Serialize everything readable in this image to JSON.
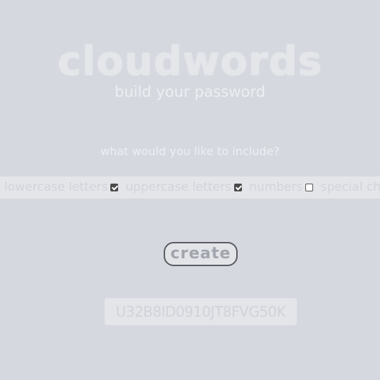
{
  "header": {
    "logo_text": "cloudwords",
    "subtitle": "build your password"
  },
  "options": {
    "question": "what would you like to include?",
    "items": [
      {
        "label": "lowercase letters",
        "checked": true
      },
      {
        "label": "uppercase letters",
        "checked": true
      },
      {
        "label": "numbers",
        "checked": false
      },
      {
        "label": "special characters",
        "checked": false
      }
    ]
  },
  "actions": {
    "create_label": "create"
  },
  "result": {
    "password": "U32B8ID0910JT8FVG50K"
  },
  "colors": {
    "background": "#d5d8df",
    "panel": "#e3e5e9",
    "text_light": "#eceef1",
    "button_border": "#5b5d63"
  }
}
